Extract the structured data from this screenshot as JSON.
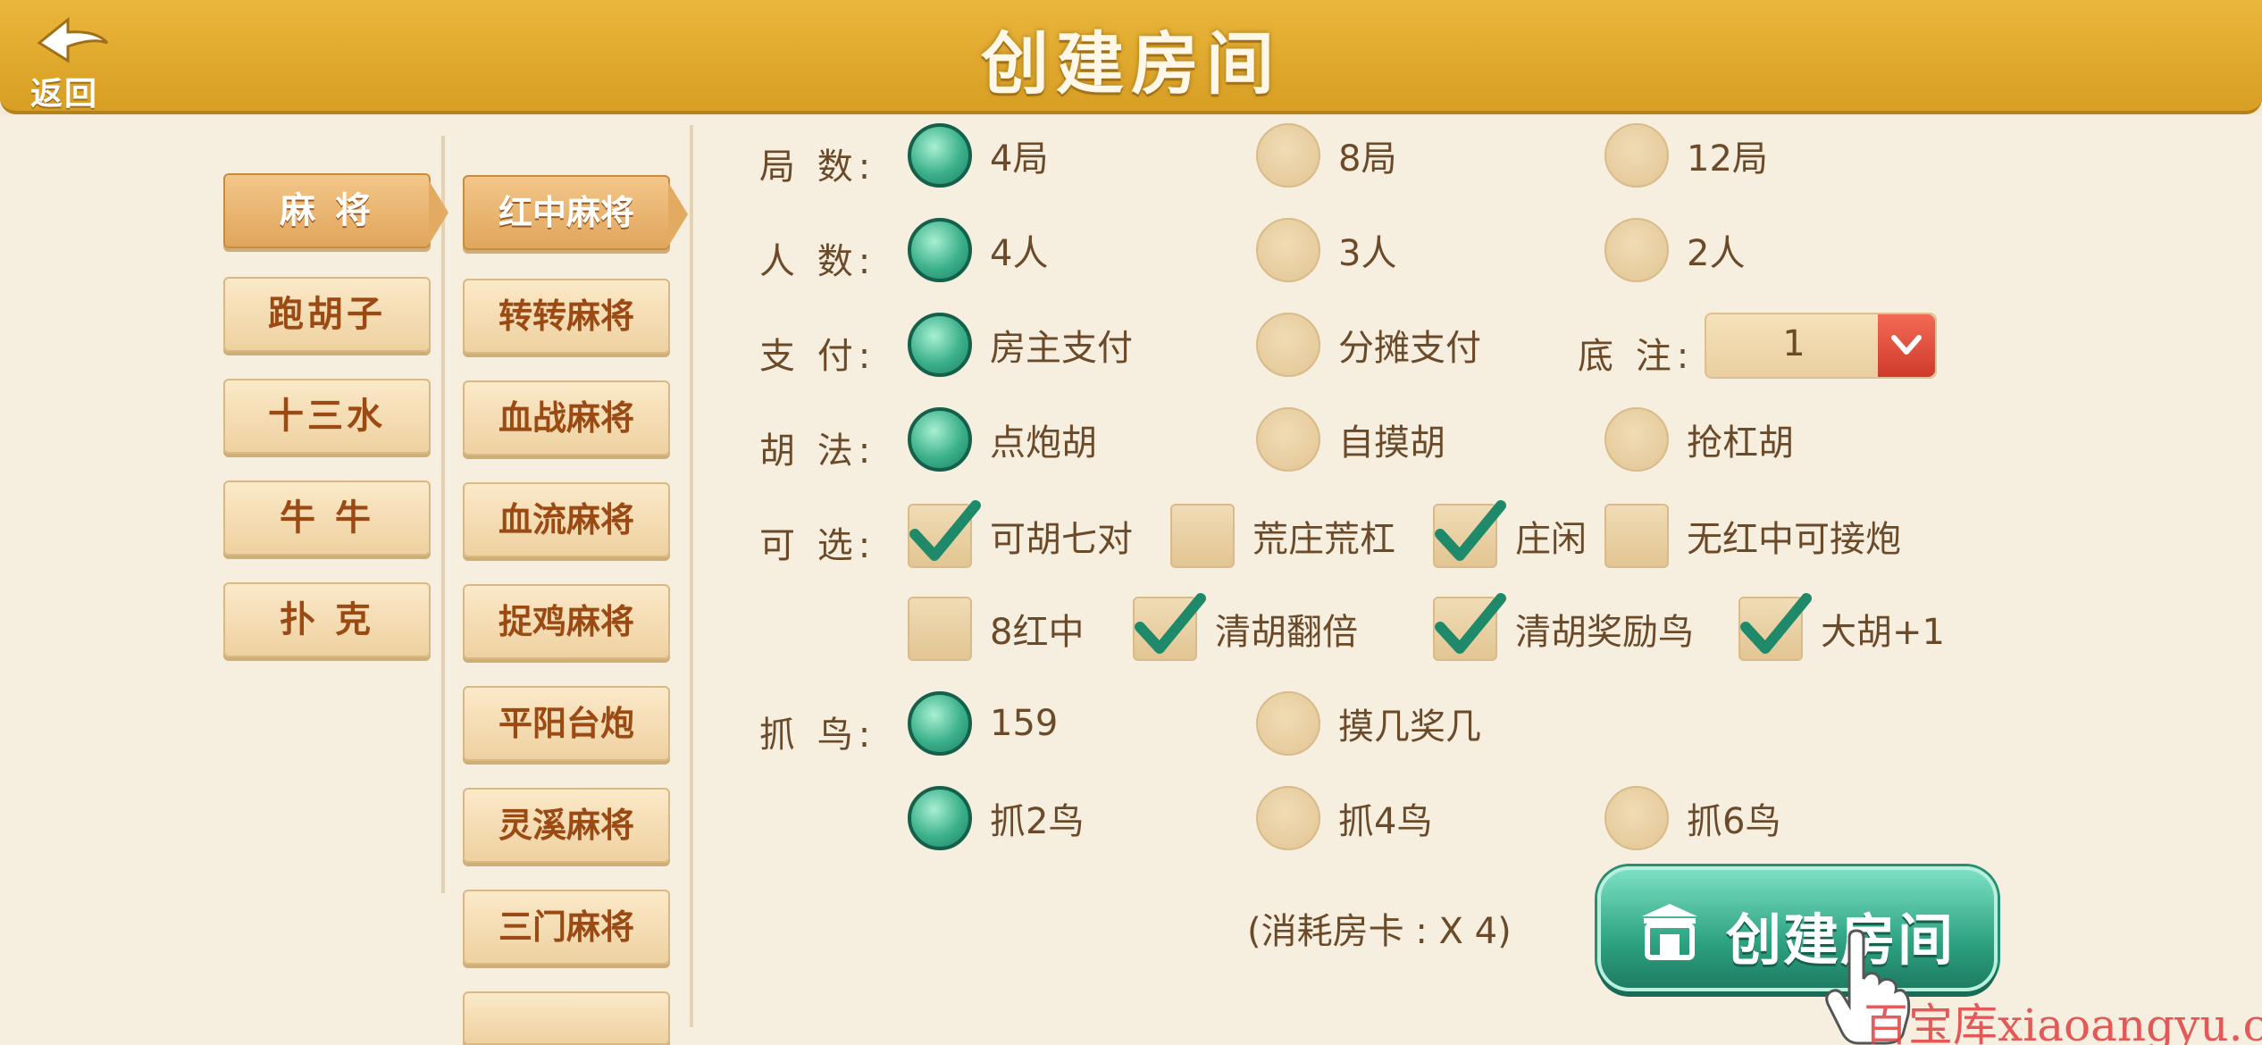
{
  "header": {
    "back_label": "返回",
    "title": "创建房间"
  },
  "categories": [
    {
      "label": "麻 将",
      "selected": true
    },
    {
      "label": "跑胡子",
      "selected": false
    },
    {
      "label": "十三水",
      "selected": false
    },
    {
      "label": "牛 牛",
      "selected": false
    },
    {
      "label": "扑 克",
      "selected": false
    }
  ],
  "variants": [
    {
      "label": "红中麻将",
      "selected": true
    },
    {
      "label": "转转麻将",
      "selected": false
    },
    {
      "label": "血战麻将",
      "selected": false
    },
    {
      "label": "血流麻将",
      "selected": false
    },
    {
      "label": "捉鸡麻将",
      "selected": false
    },
    {
      "label": "平阳台炮",
      "selected": false
    },
    {
      "label": "灵溪麻将",
      "selected": false
    },
    {
      "label": "三门麻将",
      "selected": false
    }
  ],
  "rows": {
    "rounds": {
      "label": "局 数:",
      "options": [
        "4局",
        "8局",
        "12局"
      ],
      "selected": 0
    },
    "players": {
      "label": "人 数:",
      "options": [
        "4人",
        "3人",
        "2人"
      ],
      "selected": 0
    },
    "payment": {
      "label": "支 付:",
      "options": [
        "房主支付",
        "分摊支付"
      ],
      "selected": 0
    },
    "base_bet": {
      "label": "底 注:",
      "value": "1"
    },
    "win_rule": {
      "label": "胡 法:",
      "options": [
        "点炮胡",
        "自摸胡",
        "抢杠胡"
      ],
      "selected": 0
    },
    "optional": {
      "label": "可 选:",
      "line1": [
        {
          "label": "可胡七对",
          "checked": true
        },
        {
          "label": "荒庄荒杠",
          "checked": false
        },
        {
          "label": "庄闲",
          "checked": true
        },
        {
          "label": "无红中可接炮",
          "checked": false
        }
      ],
      "line2": [
        {
          "label": "8红中",
          "checked": false
        },
        {
          "label": "清胡翻倍",
          "checked": true
        },
        {
          "label": "清胡奖励鸟",
          "checked": true
        },
        {
          "label": "大胡+1",
          "checked": true
        }
      ]
    },
    "bird": {
      "label": "抓 鸟:",
      "line1": [
        "159",
        "摸几奖几"
      ],
      "line1_selected": 0,
      "line2": [
        "抓2鸟",
        "抓4鸟",
        "抓6鸟"
      ],
      "line2_selected": 0
    }
  },
  "cost_text": "(消耗房卡 : X 4)",
  "create_button": "创建房间",
  "watermark": "百宝库xiaoangyu.cn",
  "colors": {
    "header": "#dca528",
    "selected_radio": "#2ea382",
    "accent_red": "#d03a2b"
  }
}
